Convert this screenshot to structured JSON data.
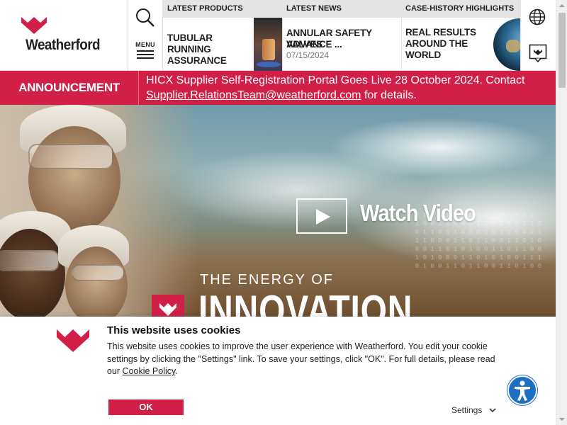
{
  "brand": {
    "name": "Weatherford",
    "accent": "#d21f47"
  },
  "header": {
    "menu_label": "MENU",
    "promos": [
      {
        "heading": "LATEST PRODUCTS",
        "title": "TUBULAR RUNNING ASSURANCE"
      },
      {
        "heading": "LATEST NEWS",
        "title_line1": "ANNULAR SAFETY VALVES",
        "title_line2": "ADVANCE ...",
        "date": "07/15/2024"
      },
      {
        "heading": "CASE-HISTORY HIGHLIGHTS",
        "title_line1": "REAL RESULTS",
        "title_line2": "AROUND THE",
        "title_line3": "WORLD"
      }
    ],
    "icons": {
      "search": "search-icon",
      "menu": "hamburger-icon",
      "globe": "globe-icon",
      "bookmark": "bookmark-icon"
    }
  },
  "announcement": {
    "label": "ANNOUNCEMENT",
    "text_before": "HICX Supplier Self-Registration Portal Goes Live 28 October 2024. Contact ",
    "email": "Supplier.RelationsTeam@weatherford.com",
    "text_after": " for details."
  },
  "hero": {
    "watch_label": "Watch Video",
    "tagline_small": "THE ENERGY OF",
    "tagline_large": "INNOVATION"
  },
  "cookie": {
    "title": "This website uses cookies",
    "body": "This website uses cookies to improve the user experience with Weatherford. You edit your cookie settings by clicking the \"Settings\" link. To save your settings, click \"OK\". For full details, please read our ",
    "policy_link": "Cookie Policy",
    "body_end": ".",
    "ok_label": "OK",
    "settings_label": "Settings"
  }
}
